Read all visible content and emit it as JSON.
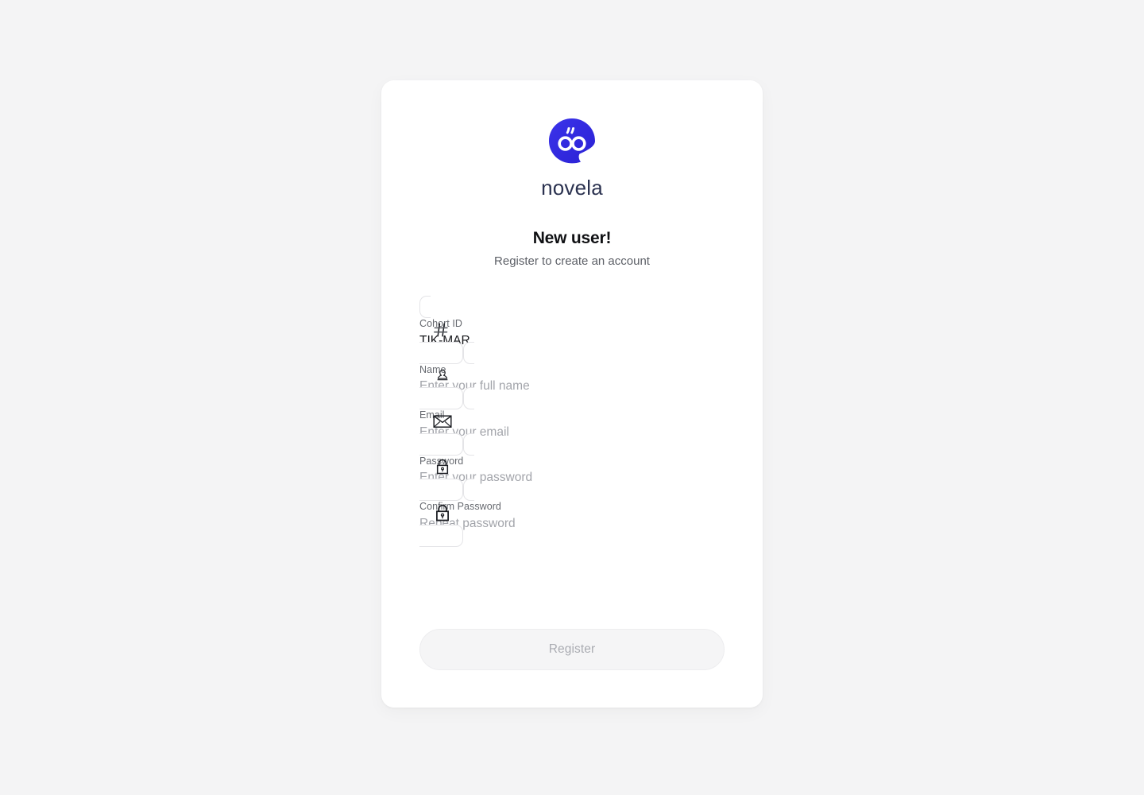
{
  "brand": {
    "name": "novela",
    "logo_icon": "speech-bubble-quote-logo",
    "logo_color": "#3026df",
    "wordmark_color": "#2b3250"
  },
  "heading": {
    "title": "New user!",
    "subtitle": "Register to create an account"
  },
  "form": {
    "fields": [
      {
        "label": "Cohort ID",
        "value": "TIK-MAR",
        "placeholder": "",
        "icon": "hash-icon",
        "type": "text"
      },
      {
        "label": "Name",
        "value": "",
        "placeholder": "Enter your full name",
        "icon": "person-icon",
        "type": "text"
      },
      {
        "label": "Email",
        "value": "",
        "placeholder": "Enter your email",
        "icon": "envelope-icon",
        "type": "text"
      },
      {
        "label": "Password",
        "value": "",
        "placeholder": "Enter your password",
        "icon": "lock-icon",
        "type": "password"
      },
      {
        "label": "Confirm Password",
        "value": "",
        "placeholder": "Repeat password",
        "icon": "lock-icon",
        "type": "password"
      }
    ],
    "submit_label": "Register",
    "submit_disabled": true
  },
  "colors": {
    "page_background": "#f4f4f5",
    "card_background": "#ffffff",
    "field_border": "#e4e4e7",
    "placeholder_text": "#a2a4aa",
    "label_text": "#66696f",
    "value_text": "#17181c",
    "disabled_button_background": "#f5f5f6",
    "disabled_button_text": "#aaacb2"
  }
}
